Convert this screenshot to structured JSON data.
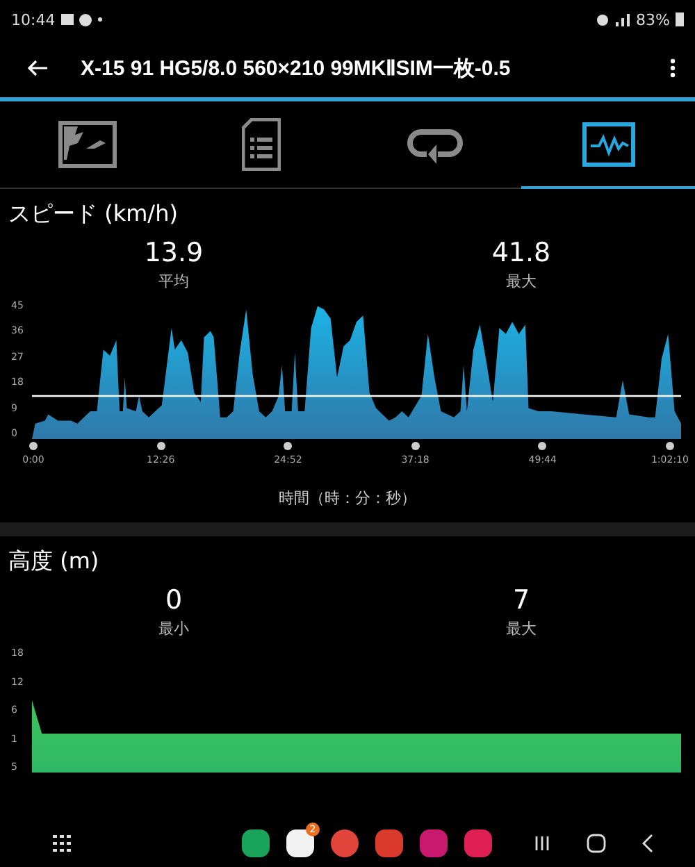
{
  "status_bar": {
    "time": "10:44",
    "battery": "83%"
  },
  "app_bar": {
    "title": "X-15 91 HG5/8.0 560×210 99MKⅡSIM一枚-0.5"
  },
  "tabs": [
    {
      "kind": "map",
      "selected": false
    },
    {
      "kind": "details",
      "selected": false
    },
    {
      "kind": "laps",
      "selected": false
    },
    {
      "kind": "chart",
      "selected": true
    }
  ],
  "speed": {
    "title": "スピード (km/h)",
    "stats": [
      {
        "value": "13.9",
        "label": "平均"
      },
      {
        "value": "41.8",
        "label": "最大"
      }
    ],
    "y_labels": [
      "45",
      "36",
      "27",
      "18",
      "9",
      "0"
    ],
    "x_labels": [
      "0:00",
      "12:26",
      "24:52",
      "37:18",
      "49:44",
      "1:02:10"
    ],
    "axis_title": "時間（時：分：秒）"
  },
  "altitude": {
    "title": "高度 (m)",
    "stats": [
      {
        "value": "0",
        "label": "最小"
      },
      {
        "value": "7",
        "label": "最大"
      }
    ],
    "y_labels": [
      "18",
      "12",
      "6",
      "1",
      "5"
    ]
  },
  "nav_bar": {
    "mail_badge": "2"
  }
}
